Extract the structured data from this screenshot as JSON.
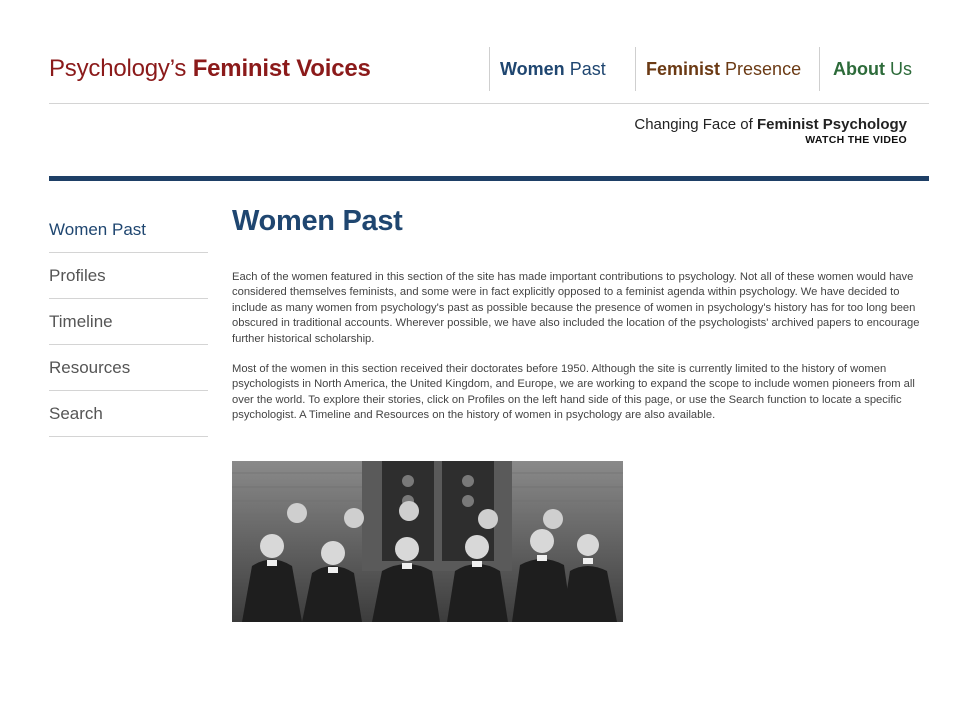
{
  "header": {
    "title_regular": "Psychology’s",
    "title_bold": "Feminist Voices"
  },
  "topnav": {
    "items": [
      {
        "bold": "Women",
        "regular": "Past"
      },
      {
        "bold": "Feminist",
        "regular": "Presence"
      },
      {
        "bold": "About",
        "regular": "Us"
      }
    ]
  },
  "promo": {
    "lead": "Changing Face of",
    "bold": "Feminist Psychology",
    "link": "WATCH THE VIDEO"
  },
  "sidebar": {
    "items": [
      {
        "label": "Women Past"
      },
      {
        "label": "Profiles"
      },
      {
        "label": "Timeline"
      },
      {
        "label": "Resources"
      },
      {
        "label": "Search"
      }
    ]
  },
  "main": {
    "title": "Women Past",
    "paragraphs": [
      "Each of the women featured in this section of the site has made important contributions to psychology.  Not all of these women would have considered themselves feminists, and some were in fact explicitly opposed to a feminist agenda within psychology.  We have decided to include as many women from psychology's past as possible because the presence of women in psychology's history has for too long been obscured in traditional accounts.  Wherever possible, we have also included the location of the psychologists' archived papers to encourage further historical scholarship.",
      "Most of the women in this section received their doctorates before 1950. Although the site is currently limited to the history of women psychologists in North America, the United Kingdom, and Europe, we are working to expand the scope to include women pioneers from all over the world. To explore their stories, click on Profiles on the left hand side of this page, or use the Search function to locate a specific psychologist.  A Timeline and Resources on the history of women in psychology are also available."
    ]
  },
  "colors": {
    "brand_red": "#8b1a1a",
    "nav_blue": "#1f4670",
    "nav_brown": "#6b3a14",
    "nav_green": "#2d6b3a",
    "bar_blue": "#1e3f66"
  }
}
